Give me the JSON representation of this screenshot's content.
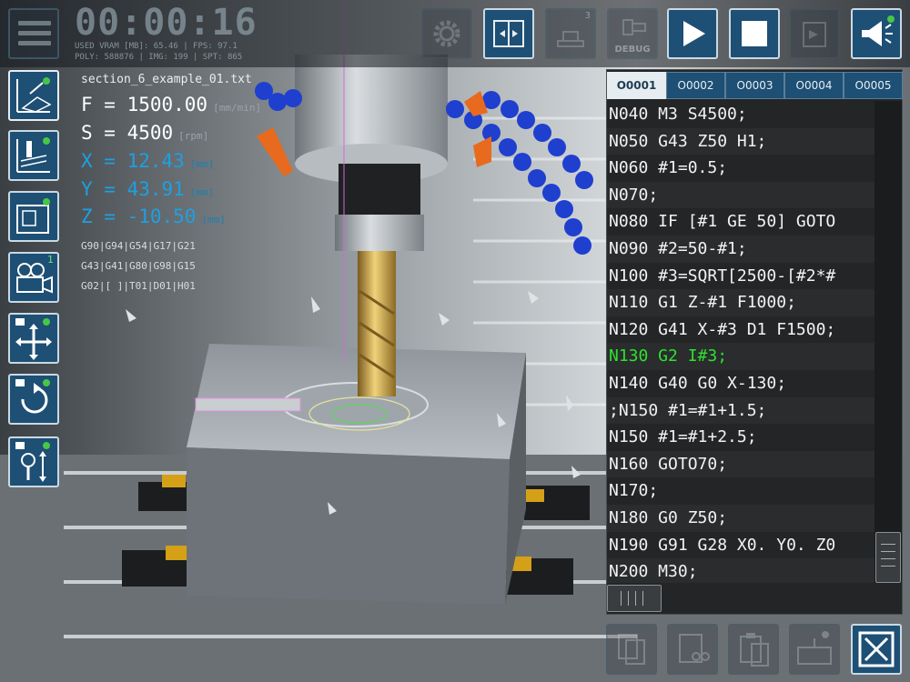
{
  "header": {
    "timer": "00:00:16",
    "stats_line1": "USED VRAM [MB]: 65.46 | FPS: 97.1",
    "stats_line2": "POLY: 588876 | IMG: 199 | SPT: 865"
  },
  "toolbar": {
    "layers_badge": "3",
    "debug_label": "DEBUG",
    "camera_badge": "1"
  },
  "info": {
    "filename": "section_6_example_01.txt",
    "feed_label": "F = 1500.00",
    "feed_unit": "[mm/min]",
    "speed_label": "S = 4500",
    "speed_unit": "[rpm]",
    "x_label": "X = 12.43",
    "y_label": "Y = 43.91",
    "z_label": "Z = -10.50",
    "axis_unit": "[mm]",
    "gcode_line1": "G90|G94|G54|G17|G21",
    "gcode_line2": "G43|G41|G80|G98|G15",
    "gcode_line3": "G02|[ ]|T01|D01|H01"
  },
  "editor": {
    "tabs": [
      "O0001",
      "O0002",
      "O0003",
      "O0004",
      "O0005"
    ],
    "active_tab": "O0001",
    "lines": [
      "N040 M3 S4500;",
      "N050 G43 Z50 H1;",
      "N060 #1=0.5;",
      "N070;",
      "N080 IF [#1 GE 50] GOTO",
      "N090 #2=50-#1;",
      "N100 #3=SQRT[2500-[#2*#",
      "N110 G1 Z-#1 F1000;",
      "N120 G41 X-#3 D1 F1500;",
      "N130 G2 I#3;",
      "N140 G40 G0 X-130;",
      ";N150 #1=#1+1.5;",
      "N150 #1=#1+2.5;",
      "N160 GOTO70;",
      "N170;",
      "N180 G0 Z50;",
      "N190 G91 G28 X0. Y0. Z0",
      "N200 M30;"
    ],
    "highlighted_line": "N130 G2 I#3;"
  },
  "colors": {
    "button_blue": "#1e4f74",
    "axis_blue": "#1ea0e0",
    "highlight_green": "#2de22d",
    "editor_bg": "#232527"
  },
  "icons": [
    "menu-icon",
    "gear-icon",
    "tool-change-icon",
    "layers-icon",
    "debug-icon",
    "play-icon",
    "stop-icon",
    "export-icon",
    "sound-icon",
    "grid-view-icon",
    "toolpath-view-icon",
    "machine-view-icon",
    "camera-icon",
    "move-icon",
    "rotate-icon",
    "zoom-icon",
    "copy-icon",
    "cut-icon",
    "paste-icon",
    "keyboard-icon",
    "close-icon"
  ]
}
